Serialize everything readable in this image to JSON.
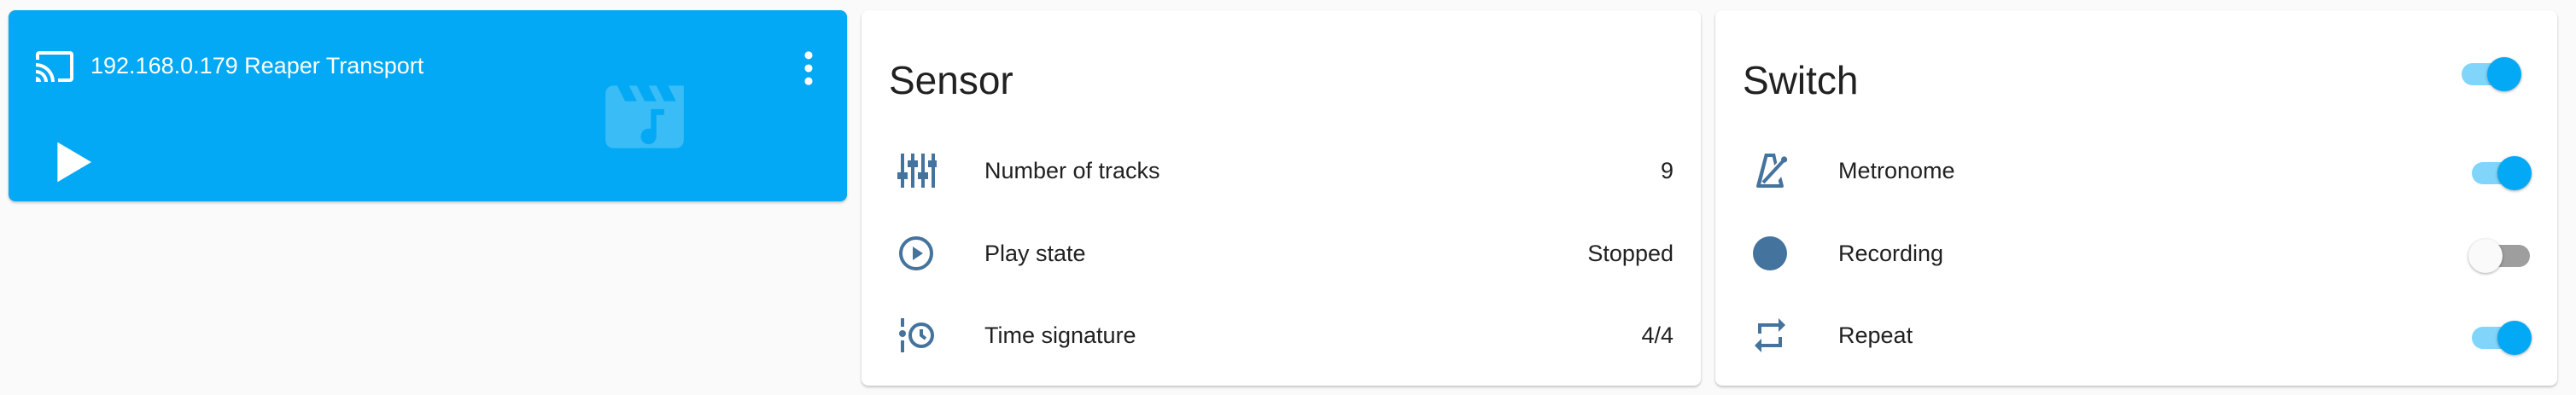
{
  "media_player": {
    "title": "192.168.0.179 Reaper Transport",
    "icons": {
      "cast": "cast-icon",
      "menu": "dots-vertical-icon",
      "play": "play-icon",
      "art": "movie-music-icon"
    },
    "colors": {
      "background": "#03a9f4",
      "foreground": "#ffffff"
    }
  },
  "sensor": {
    "title": "Sensor",
    "rows": [
      {
        "icon": "tune-vertical-icon",
        "label": "Number of tracks",
        "value": "9"
      },
      {
        "icon": "play-circle-outline-icon",
        "label": "Play state",
        "value": "Stopped"
      },
      {
        "icon": "timeline-clock-icon",
        "label": "Time signature",
        "value": "4/4"
      }
    ]
  },
  "switch": {
    "title": "Switch",
    "header_toggle_on": true,
    "rows": [
      {
        "icon": "metronome-icon",
        "label": "Metronome",
        "on": true
      },
      {
        "icon": "record-icon",
        "label": "Recording",
        "on": false
      },
      {
        "icon": "repeat-icon",
        "label": "Repeat",
        "on": true
      }
    ]
  },
  "colors": {
    "icon": "#44739e",
    "accent": "#03a9f4",
    "accent_track": "#81d4fa",
    "text": "#212121"
  }
}
